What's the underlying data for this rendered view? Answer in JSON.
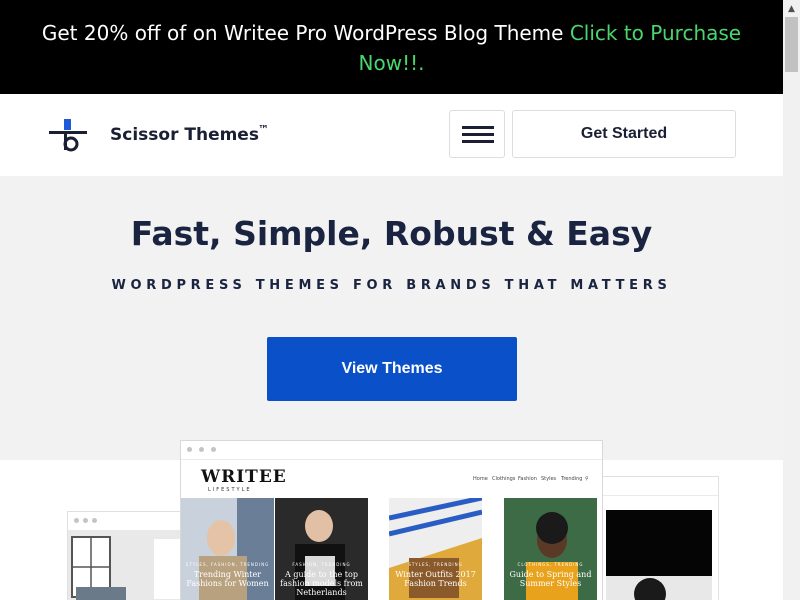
{
  "promo": {
    "text": "Get 20% off of on Writee Pro WordPress Blog Theme ",
    "link": "Click to Purchase Now!!."
  },
  "header": {
    "brand": "Scissor Themes",
    "trademark": "™",
    "cta": "Get Started"
  },
  "hero": {
    "title": "Fast, Simple, Robust & Easy",
    "subtitle": "WORDPRESS THEMES FOR BRANDS THAT MATTERS",
    "button": "View Themes"
  },
  "preview": {
    "logo": "WRITEE",
    "logo_sub": "LIFESTYLE",
    "nav": [
      "Home",
      "Clothings",
      "Fashion",
      "Styles",
      "Trending"
    ],
    "tiles": [
      {
        "kicker": "STYLES, FASHION, TRENDING",
        "caption": "Trending Winter Fashions for Women"
      },
      {
        "kicker": "FASHION, TRENDING",
        "caption": "A guide to the top fashion models from Netherlands"
      },
      {
        "kicker": "STYLES, TRENDING",
        "caption": "Winter Outfits 2017 Fashion Trends"
      },
      {
        "kicker": "CLOTHINGS, TRENDING",
        "caption": "Guide to Spring and Summer Styles"
      }
    ]
  },
  "colors": {
    "promo_bg": "#000000",
    "promo_link": "#4ad66d",
    "accent": "#0a50c8",
    "heading": "#1a2440"
  }
}
